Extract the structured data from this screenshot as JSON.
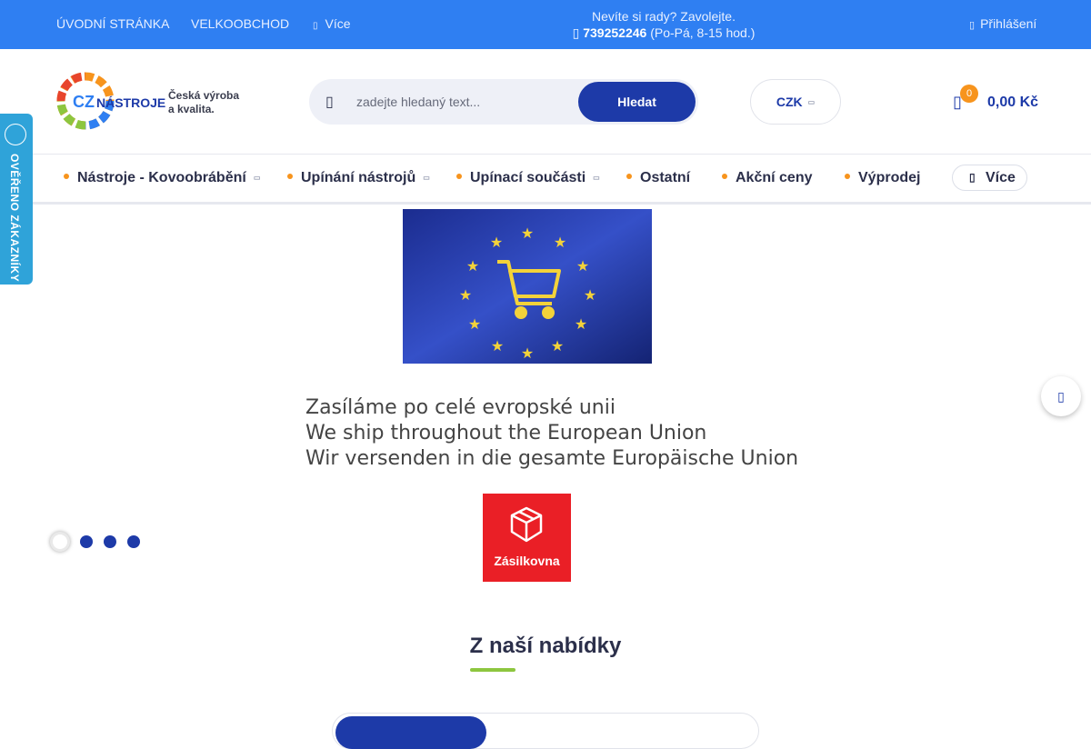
{
  "topbar": {
    "home": "ÚVODNÍ STRÁNKA",
    "wholesale": "VELKOOBCHOD",
    "more_icon": "chevron-icon",
    "more": "Více",
    "help_line1": "Nevíte si rady? Zavolejte.",
    "phone_icon": "phone-icon",
    "phone": "739252246",
    "hours": "(Po-Pá, 8-15 hod.)",
    "login_icon": "user-icon",
    "login": "Přihlášení"
  },
  "header": {
    "logo_cz": "CZ",
    "logo_name": "NÁSTROJE",
    "tagline_line1": "Česká výroba",
    "tagline_line2": "a kvalita.",
    "search_placeholder": "zadejte hledaný text...",
    "search_button": "Hledat",
    "currency": "CZK",
    "cart_count": "0",
    "cart_total": "0,00 Kč"
  },
  "nav": {
    "items": [
      {
        "label": "Nástroje - Kovoobrábění"
      },
      {
        "label": "Upínání nástrojů"
      },
      {
        "label": "Upínací součásti"
      },
      {
        "label": "Ostatní"
      },
      {
        "label": "Akční ceny"
      },
      {
        "label": "Výprodej"
      }
    ],
    "more": "Více"
  },
  "verified_badge": {
    "text": "OVĚŘENO ZÁKAZNÍKY"
  },
  "banner": {
    "line1": "Zasíláme po celé evropské unii",
    "line2": "We ship throughout the European Union",
    "line3": "Wir versenden in die gesamte Europäische Union",
    "carrier": "Zásilkovna",
    "slide_count": 4,
    "active_slide": 1
  },
  "section": {
    "title": "Z naší nabídky"
  },
  "colors": {
    "topbar": "#2f7ff2",
    "primary": "#1d3aa8",
    "accent": "#f7941d",
    "green": "#8dc63f",
    "badge": "#2fa3d9",
    "carrier_red": "#ea1f26"
  }
}
